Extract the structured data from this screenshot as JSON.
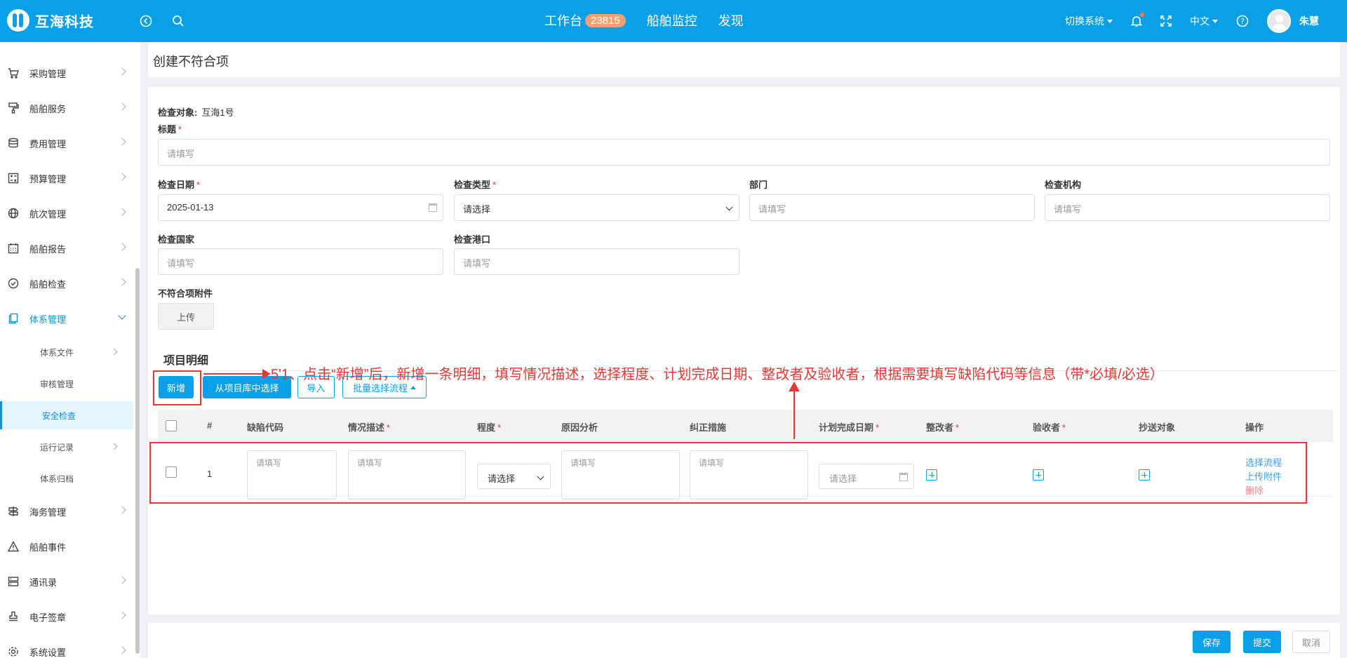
{
  "app": {
    "logo_text": "互海科技"
  },
  "topnav": {
    "workbench": "工作台",
    "workbench_badge": "23815",
    "ship_monitor": "船舶监控",
    "discover": "发现"
  },
  "toolbar": {
    "switch_system": "切换系统",
    "language": "中文",
    "username": "朱慧"
  },
  "sidebar": {
    "items": [
      {
        "label": "采购管理"
      },
      {
        "label": "船舶服务"
      },
      {
        "label": "费用管理"
      },
      {
        "label": "预算管理"
      },
      {
        "label": "航次管理"
      },
      {
        "label": "船舶报告"
      },
      {
        "label": "船舶检查"
      },
      {
        "label": "体系管理"
      },
      {
        "label": "海务管理"
      },
      {
        "label": "船舶事件"
      },
      {
        "label": "通讯录"
      },
      {
        "label": "电子签章"
      },
      {
        "label": "系统设置"
      }
    ],
    "subitems": [
      {
        "label": "体系文件"
      },
      {
        "label": "审核管理"
      },
      {
        "label": "安全检查"
      },
      {
        "label": "运行记录"
      },
      {
        "label": "体系归档"
      }
    ]
  },
  "page": {
    "title": "创建不符合项"
  },
  "form": {
    "target_label": "检查对象:",
    "target_value": "互海1号",
    "title_label": "标题",
    "title_placeholder": "请填写",
    "date_label": "检查日期",
    "date_value": "2025-01-13",
    "type_label": "检查类型",
    "type_placeholder": "请选择",
    "dept_label": "部门",
    "dept_placeholder": "请填写",
    "org_label": "检查机构",
    "org_placeholder": "请填写",
    "country_label": "检查国家",
    "country_placeholder": "请填写",
    "port_label": "检查港口",
    "port_placeholder": "请填写",
    "attachment_label": "不符合项附件",
    "upload_label": "上传",
    "required_mark": "*"
  },
  "detail": {
    "section_title": "项目明细",
    "add_button": "新增",
    "from_library_button": "从项目库中选择",
    "import_button": "导入",
    "batch_flow_button": "批量选择流程",
    "columns": {
      "index": "#",
      "defect_code": "缺陷代码",
      "description": "情况描述",
      "degree": "程度",
      "cause": "原因分析",
      "corrective": "纠正措施",
      "plan_date": "计划完成日期",
      "rectifier": "整改者",
      "acceptor": "验收者",
      "cc": "抄送对象",
      "ops": "操作"
    },
    "rows": [
      {
        "index": "1",
        "defect_code_placeholder": "请填写",
        "description_placeholder": "请填写",
        "degree_placeholder": "请选择",
        "cause_placeholder": "请填写",
        "corrective_placeholder": "请填写",
        "plan_date_placeholder": "请选择",
        "op_select_flow": "选择流程",
        "op_upload": "上传附件",
        "op_delete": "删除"
      }
    ]
  },
  "annotation": {
    "text": "5'1、点击“新增”后，新增一条明细，填写情况描述，选择程度、计划完成日期、整改者及验收者，根据需要填写缺陷代码等信息（带*必填/必选）"
  },
  "footer": {
    "save": "保存",
    "submit": "提交",
    "cancel": "取消"
  },
  "colors": {
    "primary": "#0aa0e8",
    "badge": "#f5a070",
    "annotation": "#e53935",
    "required": "#e33333"
  }
}
